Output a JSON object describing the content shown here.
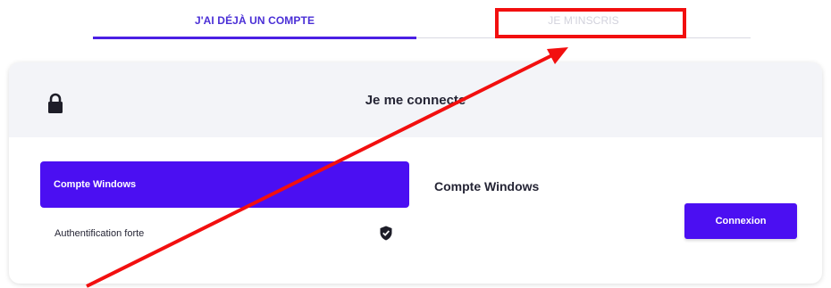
{
  "tabs": {
    "login_label": "J'AI DÉJÀ UN COMPTE",
    "signup_label": "JE M'INSCRIS"
  },
  "card": {
    "title": "Je me connecte",
    "methods": [
      {
        "label": "Compte Windows",
        "selected": true
      },
      {
        "label": "Authentification forte",
        "selected": false,
        "icon": "shield-check-icon"
      }
    ],
    "pane_title": "Compte Windows",
    "connect_label": "Connexion"
  },
  "colors": {
    "accent": "#4b0ff2",
    "annotation": "#f20f0f",
    "header_bg": "#f3f4f8"
  }
}
